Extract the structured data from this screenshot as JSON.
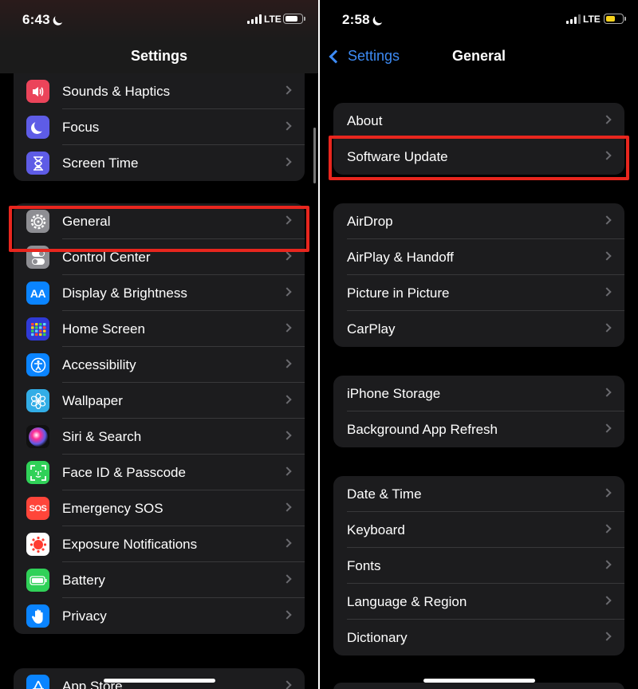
{
  "left": {
    "status": {
      "time": "6:43",
      "network": "LTE",
      "battery_color": "#ffffff"
    },
    "nav": {
      "title": "Settings"
    },
    "groups": [
      {
        "items": [
          {
            "label": "Sounds & Haptics",
            "icon": "speaker-icon",
            "color": "#eb445a"
          },
          {
            "label": "Focus",
            "icon": "moon-icon",
            "color": "#5e5ce6"
          },
          {
            "label": "Screen Time",
            "icon": "hourglass-icon",
            "color": "#5e5ce6"
          }
        ]
      },
      {
        "items": [
          {
            "label": "General",
            "icon": "gear-icon",
            "color": "#8e8e93"
          },
          {
            "label": "Control Center",
            "icon": "toggles-icon",
            "color": "#8e8e93"
          },
          {
            "label": "Display & Brightness",
            "icon": "text-size-icon",
            "color": "#0a84ff",
            "glyph": "AA"
          },
          {
            "label": "Home Screen",
            "icon": "app-grid-icon",
            "color": "#2f3ad6"
          },
          {
            "label": "Accessibility",
            "icon": "accessibility-icon",
            "color": "#0a84ff"
          },
          {
            "label": "Wallpaper",
            "icon": "flower-icon",
            "color": "#32ade6"
          },
          {
            "label": "Siri & Search",
            "icon": "siri-icon",
            "color": "#111111"
          },
          {
            "label": "Face ID & Passcode",
            "icon": "face-id-icon",
            "color": "#30d158"
          },
          {
            "label": "Emergency SOS",
            "icon": "sos-icon",
            "color": "#ff453a",
            "glyph": "SOS"
          },
          {
            "label": "Exposure Notifications",
            "icon": "exposure-icon",
            "color": "#ffffff"
          },
          {
            "label": "Battery",
            "icon": "battery-icon",
            "color": "#30d158"
          },
          {
            "label": "Privacy",
            "icon": "hand-icon",
            "color": "#0a84ff"
          }
        ]
      },
      {
        "items": [
          {
            "label": "App Store",
            "icon": "app-store-icon",
            "color": "#0a84ff"
          }
        ]
      }
    ]
  },
  "right": {
    "status": {
      "time": "2:58",
      "network": "LTE",
      "battery_color": "#f7d21c"
    },
    "nav": {
      "title": "General",
      "back_label": "Settings"
    },
    "groups": [
      {
        "items": [
          {
            "label": "About"
          },
          {
            "label": "Software Update"
          }
        ]
      },
      {
        "items": [
          {
            "label": "AirDrop"
          },
          {
            "label": "AirPlay & Handoff"
          },
          {
            "label": "Picture in Picture"
          },
          {
            "label": "CarPlay"
          }
        ]
      },
      {
        "items": [
          {
            "label": "iPhone Storage"
          },
          {
            "label": "Background App Refresh"
          }
        ]
      },
      {
        "items": [
          {
            "label": "Date & Time"
          },
          {
            "label": "Keyboard"
          },
          {
            "label": "Fonts"
          },
          {
            "label": "Language & Region"
          },
          {
            "label": "Dictionary"
          }
        ]
      }
    ]
  },
  "highlight_color": "#e8261e"
}
